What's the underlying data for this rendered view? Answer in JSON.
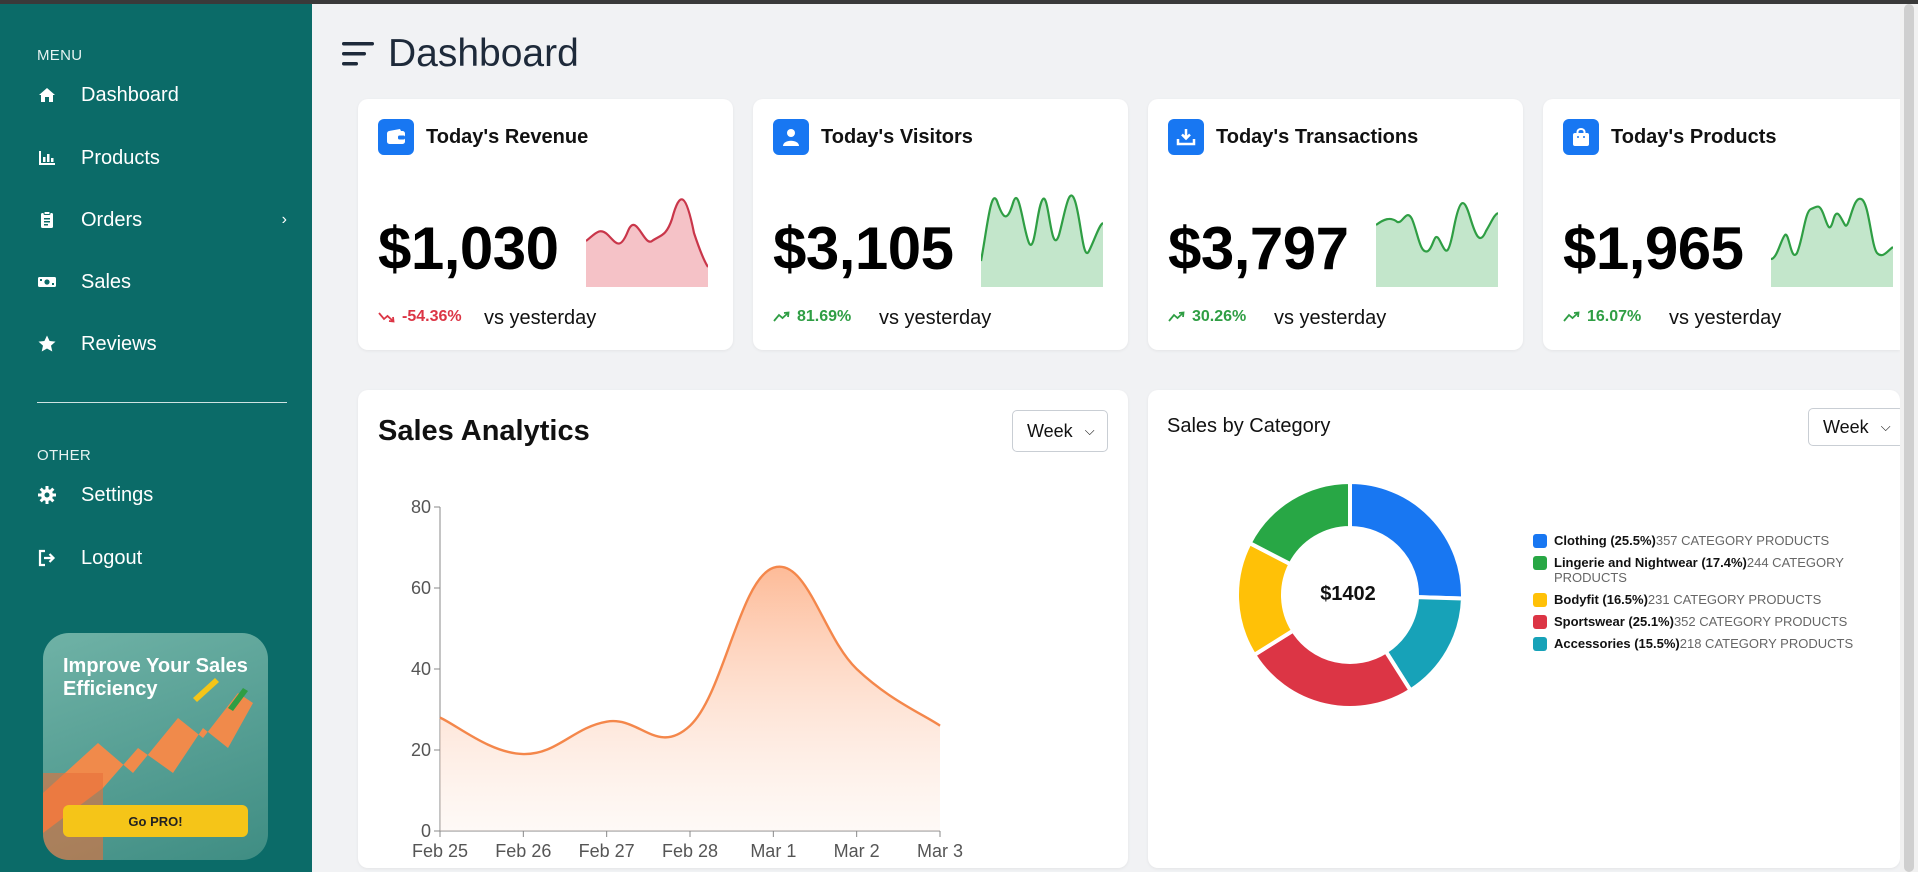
{
  "sidebar": {
    "menu_label": "MENU",
    "items": [
      {
        "label": "Dashboard",
        "icon": "home-icon"
      },
      {
        "label": "Products",
        "icon": "bar-chart-icon"
      },
      {
        "label": "Orders",
        "icon": "clipboard-icon"
      },
      {
        "label": "Sales",
        "icon": "money-icon"
      },
      {
        "label": "Reviews",
        "icon": "star-icon"
      }
    ],
    "other_label": "OTHER",
    "other_items": [
      {
        "label": "Settings",
        "icon": "gear-icon"
      },
      {
        "label": "Logout",
        "icon": "logout-icon"
      }
    ],
    "promo": {
      "title": "Improve Your Sales Efficiency",
      "button": "Go PRO!"
    }
  },
  "header": {
    "title": "Dashboard"
  },
  "stats": [
    {
      "title": "Today's Revenue",
      "value": "$1,030",
      "change": "-54.36%",
      "trend": "down",
      "vs": "vs yesterday",
      "icon": "wallet-icon",
      "color": "#dc3545",
      "fill": "#f5c2c7"
    },
    {
      "title": "Today's Visitors",
      "value": "$3,105",
      "change": "81.69%",
      "trend": "up",
      "vs": "vs yesterday",
      "icon": "user-icon",
      "color": "#2f9e44",
      "fill": "#c3e6cb"
    },
    {
      "title": "Today's Transactions",
      "value": "$3,797",
      "change": "30.26%",
      "trend": "up",
      "vs": "vs yesterday",
      "icon": "download-icon",
      "color": "#2f9e44",
      "fill": "#c3e6cb"
    },
    {
      "title": "Today's Products",
      "value": "$1,965",
      "change": "16.07%",
      "trend": "up",
      "vs": "vs yesterday",
      "icon": "shopping-bag-icon",
      "color": "#2f9e44",
      "fill": "#c3e6cb"
    }
  ],
  "analytics": {
    "title": "Sales Analytics",
    "period": "Week"
  },
  "category": {
    "title": "Sales by Category",
    "period": "Week",
    "center_value": "$1402",
    "items": [
      {
        "name": "Clothing (25.5%)",
        "products": "357 CATEGORY PRODUCTS",
        "color": "#1877f2"
      },
      {
        "name": "Lingerie and Nightwear (17.4%)",
        "products": "244 CATEGORY PRODUCTS",
        "color": "#28a745"
      },
      {
        "name": "Bodyfit (16.5%)",
        "products": "231 CATEGORY PRODUCTS",
        "color": "#ffc107"
      },
      {
        "name": "Sportswear (25.1%)",
        "products": "352 CATEGORY PRODUCTS",
        "color": "#dc3545"
      },
      {
        "name": "Accessories (15.5%)",
        "products": "218 CATEGORY PRODUCTS",
        "color": "#17a2b8"
      }
    ]
  },
  "chart_data": [
    {
      "type": "area",
      "title": "Sales Analytics",
      "categories": [
        "Feb 25",
        "Feb 26",
        "Feb 27",
        "Feb 28",
        "Mar 1",
        "Mar 2",
        "Mar 3"
      ],
      "series": [
        {
          "values": [
            28,
            19,
            27,
            26,
            65,
            40,
            26
          ]
        }
      ],
      "ylim": [
        0,
        80
      ],
      "yticks": [
        0,
        20,
        40,
        60,
        80
      ],
      "grid": false,
      "color": "#f4874b"
    },
    {
      "type": "pie",
      "title": "Sales by Category",
      "categories": [
        "Clothing",
        "Lingerie and Nightwear",
        "Bodyfit",
        "Sportswear",
        "Accessories"
      ],
      "values": [
        25.5,
        17.4,
        16.5,
        25.1,
        15.5
      ],
      "order_clockwise_from_top": [
        "Clothing",
        "Accessories",
        "Sportswear",
        "Bodyfit",
        "Lingerie and Nightwear"
      ],
      "legend": "right"
    }
  ]
}
